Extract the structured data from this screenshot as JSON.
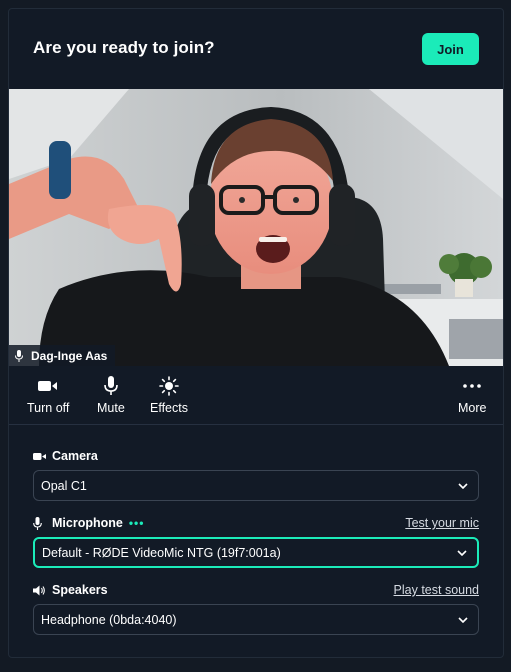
{
  "header": {
    "title": "Are you ready to join?",
    "join_label": "Join"
  },
  "video": {
    "participant_name": "Dag-Inge Aas"
  },
  "controls": {
    "camera_label": "Turn off",
    "mute_label": "Mute",
    "effects_label": "Effects",
    "more_label": "More"
  },
  "settings": {
    "camera": {
      "label": "Camera",
      "value": "Opal C1"
    },
    "microphone": {
      "label": "Microphone",
      "link": "Test your mic",
      "value": "Default - RØDE VideoMic NTG (19f7:001a)"
    },
    "speakers": {
      "label": "Speakers",
      "link": "Play test sound",
      "value": "Headphone (0bda:4040)"
    }
  },
  "colors": {
    "accent": "#1bebb9",
    "panel": "#121a26",
    "background": "#131a24"
  }
}
